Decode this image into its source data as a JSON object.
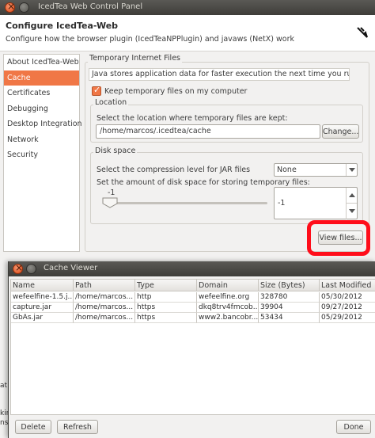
{
  "main_window": {
    "title": "IcedTea Web Control Panel",
    "header_title": "Configure IcedTea-Web",
    "header_subtitle": "Configure how the browser plugin (IcedTeaNPPlugin) and javaws (NetX) work"
  },
  "sidebar": {
    "items": [
      {
        "label": "About IcedTea-Web"
      },
      {
        "label": "Cache"
      },
      {
        "label": "Certificates"
      },
      {
        "label": "Debugging"
      },
      {
        "label": "Desktop Integration"
      },
      {
        "label": "Network"
      },
      {
        "label": "Security"
      }
    ],
    "selected_index": 1
  },
  "cache_panel": {
    "section_title": "Temporary Internet Files",
    "info_text": "Java stores application data for faster execution the next time you run it.",
    "keep_files_label": "Keep temporary files on my computer",
    "keep_files_checked": true,
    "location": {
      "title": "Location",
      "prompt": "Select the location where temporary files are kept:",
      "path": "/home/marcos/.icedtea/cache",
      "change_button": "Change..."
    },
    "disk_space": {
      "title": "Disk space",
      "compression_label": "Select the compression level for JAR files",
      "compression_value": "None",
      "amount_label": "Set the amount of disk space for storing temporary files:",
      "slider_value_label": "-1",
      "spinner_value": "-1"
    },
    "view_files_button": "View files..."
  },
  "cache_viewer": {
    "title": "Cache Viewer",
    "columns": [
      "Name",
      "Path",
      "Type",
      "Domain",
      "Size (Bytes)",
      "Last Modified"
    ],
    "rows": [
      [
        "wefeelfine-1.5.j...",
        "/home/marcos...",
        "http",
        "wefeelfine.org",
        "328780",
        "05/30/2012"
      ],
      [
        "capture.jar",
        "/home/marcos...",
        "https",
        "dkq8trv4fmcob...",
        "39904",
        "09/27/2012"
      ],
      [
        "GbAs.jar",
        "/home/marcos...",
        "https",
        "www2.bancobr...",
        "53434",
        "05/29/2012"
      ]
    ],
    "buttons": {
      "delete": "Delete",
      "refresh": "Refresh",
      "done": "Done"
    }
  },
  "background_text": {
    "line1": "at",
    "line2": "kir",
    "line3": "ns"
  }
}
